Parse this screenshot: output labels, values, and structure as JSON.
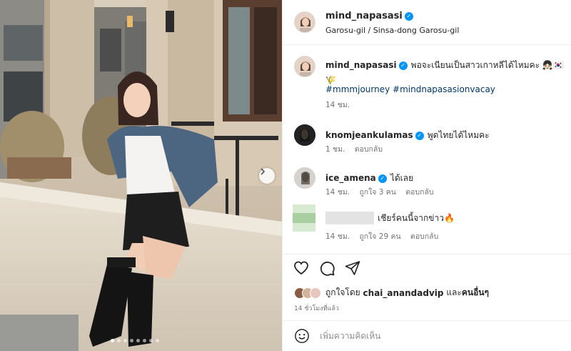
{
  "post": {
    "username": "mind_napasasi",
    "location": "Garosu-gil / Sinsa-dong Garosu-gil",
    "slide_count": 8,
    "active_slide": 1
  },
  "caption": {
    "username": "mind_napasasi",
    "text": "พอจะเนียนเป็นสาวเกาหลีได้ไหมคะ 👧🏻🇰🇷🌾",
    "dot": ".",
    "hashtags": "#mmmjourney #mindnapasasionvacay",
    "time": "14 ชม."
  },
  "comments": [
    {
      "username": "knomjeankulamas",
      "text": "พูดไทยได้ไหมคะ",
      "time": "1 ชม.",
      "likes": "",
      "reply": "ตอบกลับ"
    },
    {
      "username": "ice_amena",
      "text": "ได้เลย",
      "time": "14 ชม.",
      "likes": "ถูกใจ 3 คน",
      "reply": "ตอบกลับ"
    },
    {
      "username": "",
      "text": "เชียร์คนนี้จากข่าว🔥",
      "time": "14 ชม.",
      "likes": "ถูกใจ 29 คน",
      "reply": "ตอบกลับ"
    }
  ],
  "likes": {
    "prefix": "ถูกใจโดย",
    "user": "chai_anandadvip",
    "suffix": "และ",
    "others": "คนอื่นๆ"
  },
  "time_ago": "14 ชั่วโมงที่แล้ว",
  "comment_box": {
    "placeholder": "เพิ่มความคิดเห็น"
  },
  "icons": {
    "verified": "verified-badge-icon",
    "heart": "heart-icon",
    "comment": "comment-icon",
    "share": "paper-plane-icon",
    "emoji": "emoji-icon",
    "next": "chevron-right-icon"
  },
  "colors": {
    "verified": "#0095f6",
    "hashtag": "#00376b",
    "muted": "#737373"
  }
}
